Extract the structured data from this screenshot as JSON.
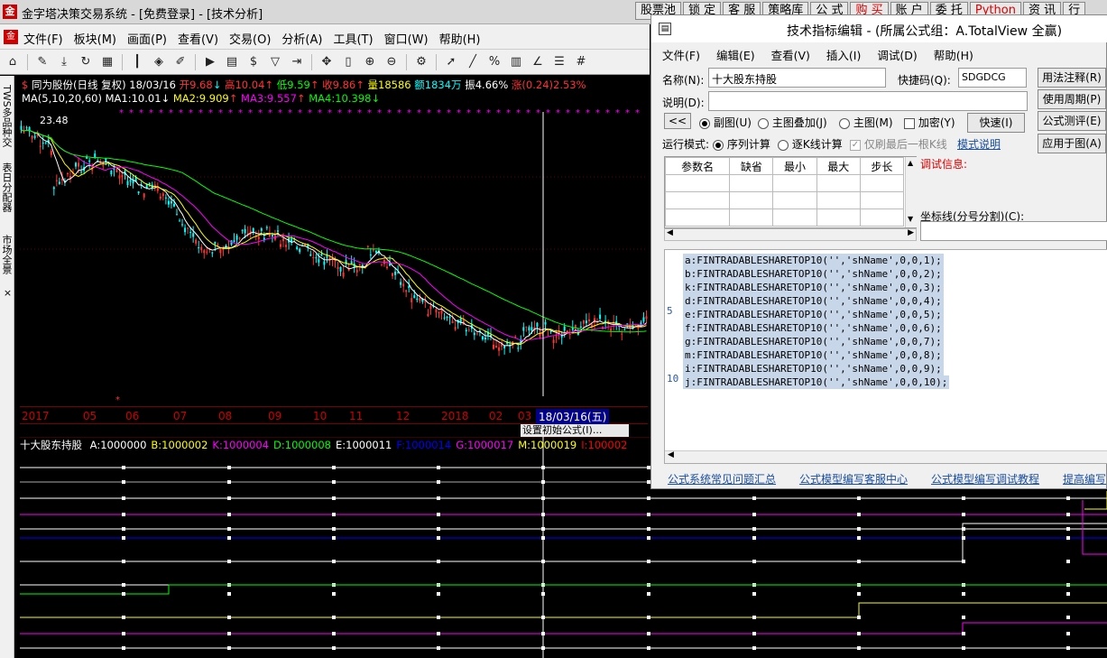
{
  "app": {
    "title": "金字塔决策交易系统 - [免费登录] - [技术分析]",
    "icon_text": "金"
  },
  "top_tabs": [
    {
      "label": "股票池",
      "red": false
    },
    {
      "label": "锁 定",
      "red": false
    },
    {
      "label": "客 服",
      "red": false
    },
    {
      "label": "策略库",
      "red": false
    },
    {
      "label": "公 式",
      "red": false
    },
    {
      "label": "购 买",
      "red": true
    },
    {
      "label": "账 户",
      "red": false
    },
    {
      "label": "委 托",
      "red": false
    },
    {
      "label": "Python",
      "red": true
    },
    {
      "label": "资 讯",
      "red": false
    },
    {
      "label": "行",
      "red": false
    }
  ],
  "menu": [
    "文件(F)",
    "板块(M)",
    "画面(P)",
    "查看(V)",
    "交易(O)",
    "分析(A)",
    "工具(T)",
    "窗口(W)",
    "帮助(H)"
  ],
  "toolbar_icons": [
    "home-icon",
    "pen-icon",
    "download-icon",
    "refresh-icon",
    "grid-icon",
    "candle-icon",
    "diamond-icon",
    "edit-icon",
    "play-icon",
    "doc-icon",
    "dollar-icon",
    "filter-icon",
    "export-icon",
    "move-icon",
    "bar-icon",
    "zoom-in-icon",
    "zoom-out-icon",
    "gear-icon",
    "cursor-icon",
    "line-icon",
    "percent-icon",
    "table-icon",
    "angle-icon",
    "list-icon",
    "hash-icon"
  ],
  "left_tabs": [
    "TWS多品种交",
    "表日分配器",
    "市场全景"
  ],
  "chart": {
    "stock_line": "同为股份(日线 复权) 18/03/16",
    "open_label": "开9.68",
    "high_label": "高10.04",
    "low_label": "低9.59",
    "close_label": "收9.86",
    "vol_label": "量18586",
    "amount_label": "额1834万",
    "amp_label": "振4.66%",
    "chg_label": "涨(0.24)2.53%",
    "ma_title": "MA(5,10,20,60)",
    "ma1": "MA1:10.01",
    "ma2": "MA2:9.909",
    "ma3": "MA3:9.557",
    "ma4": "MA4:10.398",
    "max_price_label": "23.48",
    "colors": {
      "ma1": "#ffffff",
      "ma2": "#ffff00",
      "ma3": "#ff00ff",
      "ma4": "#00ff00",
      "up": "#ff3333",
      "down": "#00ffff"
    }
  },
  "date_axis": {
    "labels": [
      "2017",
      "05",
      "06",
      "07",
      "08",
      "09",
      "10",
      "11",
      "12",
      "2018",
      "02",
      "03"
    ],
    "cursor_date": "18/03/16(五)",
    "hint": "设置初始公式(I)..."
  },
  "lower_panel": {
    "title": "十大股东持股",
    "values": [
      {
        "label": "A:1000000",
        "color": "#ffffff"
      },
      {
        "label": "B:1000002",
        "color": "#ffff00"
      },
      {
        "label": "K:1000004",
        "color": "#ff00ff"
      },
      {
        "label": "D:1000008",
        "color": "#00ff00"
      },
      {
        "label": "E:1000011",
        "color": "#ffffff"
      },
      {
        "label": "F:1000014",
        "color": "#0000ff"
      },
      {
        "label": "G:1000017",
        "color": "#ff00ff"
      },
      {
        "label": "M:1000019",
        "color": "#ffff00"
      },
      {
        "label": "I:100002",
        "color": "#ff0000"
      }
    ]
  },
  "dialog": {
    "title": "技术指标编辑 - (所属公式组：A.TotalView 全赢)",
    "menu": [
      "文件(F)",
      "编辑(E)",
      "查看(V)",
      "插入(I)",
      "调试(D)",
      "帮助(H)"
    ],
    "name_label": "名称(N):",
    "name_value": "十大股东持股",
    "shortcut_label": "快捷码(Q):",
    "shortcut_value": "SDGDCG",
    "desc_label": "说明(D):",
    "desc_value": "",
    "btn_usage": "用法注释(R)",
    "btn_period": "使用周期(P)",
    "btn_test": "公式测评(E)",
    "btn_apply": "应用于图(A)",
    "btn_back": "<<",
    "btn_fast": "快速(I)",
    "opt_sub": "副图(U)",
    "opt_overlay": "主图叠加(J)",
    "opt_main": "主图(M)",
    "opt_encrypt": "加密(Y)",
    "run_mode_label": "运行模式:",
    "mode_seq": "序列计算",
    "mode_line": "逐K线计算",
    "mode_last": "仅刷最后一根K线",
    "mode_help": "模式说明",
    "param_headers": [
      "参数名",
      "缺省",
      "最小",
      "最大",
      "步长"
    ],
    "debug_label": "调试信息:",
    "coord_label": "坐标线(分号分割)(C):",
    "code_lines": [
      "a:FINTRADABLESHARETOP10('','shName',0,0,1);",
      "b:FINTRADABLESHARETOP10('','shName',0,0,2);",
      "k:FINTRADABLESHARETOP10('','shName',0,0,3);",
      "d:FINTRADABLESHARETOP10('','shName',0,0,4);",
      "e:FINTRADABLESHARETOP10('','shName',0,0,5);",
      "f:FINTRADABLESHARETOP10('','shName',0,0,6);",
      "g:FINTRADABLESHARETOP10('','shName',0,0,7);",
      "m:FINTRADABLESHARETOP10('','shName',0,0,8);",
      "i:FINTRADABLESHARETOP10('','shName',0,0,9);",
      "j:FINTRADABLESHARETOP10('','shName',0,0,10);"
    ],
    "line_numbers": [
      "5",
      "10"
    ],
    "links": [
      "公式系统常见问题汇总",
      "公式模型编写客服中心",
      "公式模型编写调试教程",
      "提高编写"
    ]
  }
}
